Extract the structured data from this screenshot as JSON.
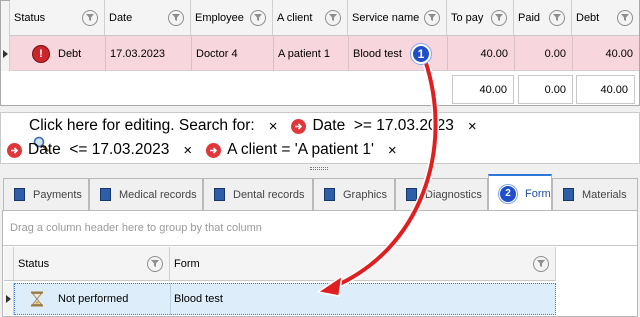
{
  "top_grid": {
    "columns": [
      "Status",
      "Date",
      "Employee",
      "A client",
      "Service name",
      "To pay",
      "Paid",
      "Debt"
    ],
    "row": {
      "status": "Debt",
      "date": "17.03.2023",
      "employee": "Doctor 4",
      "client": "A patient 1",
      "service": "Blood test",
      "to_pay": "40.00",
      "paid": "0.00",
      "debt": "40.00"
    },
    "totals": {
      "to_pay": "40.00",
      "paid": "0.00",
      "debt": "40.00"
    }
  },
  "filter_bar": {
    "prefix": "Click here for editing. Search for:",
    "conditions": [
      "Date  >= 17.03.2023",
      "Date  <= 17.03.2023",
      "A client = 'A patient 1'"
    ],
    "remove_symbol": "×"
  },
  "tabs": [
    {
      "label": "Payments"
    },
    {
      "label": "Medical records"
    },
    {
      "label": "Dental records"
    },
    {
      "label": "Graphics"
    },
    {
      "label": "Diagnostics"
    },
    {
      "label": "Form"
    },
    {
      "label": "Materials"
    }
  ],
  "bottom_grid": {
    "group_hint": "Drag a column header here to group by that column",
    "columns": [
      "Status",
      "Form"
    ],
    "row": {
      "status": "Not performed",
      "form": "Blood test"
    }
  },
  "annotations": {
    "step1": "1",
    "step2": "2"
  },
  "colors": {
    "debt_row": "#f7d6de",
    "selected_row": "#ddeefa",
    "arrow": "#e02020",
    "badge": "#1e4fc8"
  }
}
